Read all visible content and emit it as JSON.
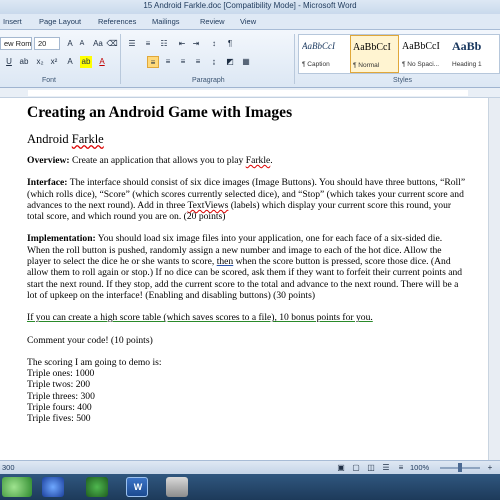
{
  "window": {
    "title": "15 Android Farkle.doc [Compatibility Mode] - Microsoft Word"
  },
  "tabs": [
    "Insert",
    "Page Layout",
    "References",
    "Mailings",
    "Review",
    "View"
  ],
  "ribbon": {
    "font_name": "ew Rom",
    "font_size": "20",
    "font_label": "Font",
    "paragraph_label": "Paragraph",
    "styles_label": "Styles",
    "styles": [
      {
        "sample": "AaBbCcI",
        "name": "¶ Caption"
      },
      {
        "sample": "AaBbCcI",
        "name": "¶ Normal"
      },
      {
        "sample": "AaBbCcI",
        "name": "¶ No Spaci..."
      },
      {
        "sample": "AaBb",
        "name": "Heading 1"
      }
    ]
  },
  "document": {
    "title": "Creating an Android Game with Images",
    "subtitle_prefix": "Android ",
    "subtitle_word": "Farkle",
    "overview_label": "Overview:",
    "overview_text": "  Create an application that allows you to play ",
    "overview_word": "Farkle",
    "overview_end": ".",
    "interface_label": "Interface:",
    "interface_text_1": "  The interface should consist of six dice images (Image Buttons).  You should have three buttons, “Roll” (which rolls dice), “Score” (which scores currently selected dice), and “Stop” (which takes your current score and advances to the next round).  Add in three ",
    "interface_word": "TextViews",
    "interface_text_2": " (labels)  which display your current score this round, your total score, and which round you are on.  (20 points)",
    "implementation_label": "Implementation:",
    "implementation_text_1": "  You should load six image files into your application, one for each face of a six-sided die.  When the roll button is pushed, randomly assign a new number and image to each of the hot dice.  Allow the player to select the dice he or she wants to score, ",
    "implementation_word": "then",
    "implementation_text_2": " when the score button is pressed, score those dice.  (And allow them to roll again or stop.)  If no dice can be scored, ask them if they want to forfeit their current points and start the next round.  If they stop, add the current score to the total and advance to the next round.  There will be a lot of upkeep on the interface!  (Enabling and disabling buttons)  (30 points)",
    "bonus_text": "If you can create a high score table (which saves scores to a file), 10 bonus points for you.",
    "comment_text": "Comment your code! (10 points)",
    "scoring_intro": "The scoring I am going to demo is:",
    "scoring": [
      "Triple ones: 1000",
      "Triple twos: 200",
      "Triple threes: 300",
      "Triple fours: 400",
      "Triple fives: 500"
    ]
  },
  "status": {
    "words": "300",
    "zoom": "100%"
  },
  "taskbar": {
    "word_label": "W"
  }
}
